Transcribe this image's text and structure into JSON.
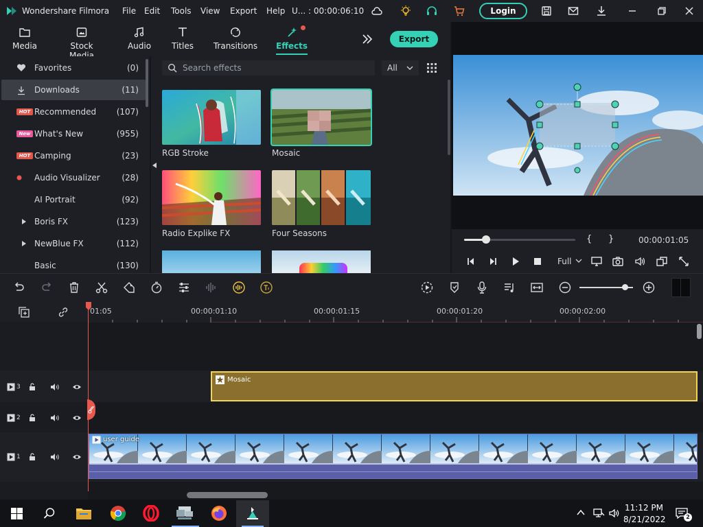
{
  "app": {
    "title": "Wondershare Filmora",
    "menu": [
      "File",
      "Edit",
      "Tools",
      "View",
      "Export",
      "Help"
    ],
    "project_status": "U... : 00:00:06:10",
    "login_label": "Login"
  },
  "tabs": [
    {
      "label": "Media",
      "icon": "folder-icon"
    },
    {
      "label": "Stock Media",
      "icon": "stock-media-icon"
    },
    {
      "label": "Audio",
      "icon": "music-note-icon"
    },
    {
      "label": "Titles",
      "icon": "text-t-icon"
    },
    {
      "label": "Transitions",
      "icon": "transition-icon"
    },
    {
      "label": "Effects",
      "icon": "effects-wand-icon",
      "active": true
    }
  ],
  "export_label": "Export",
  "categories": [
    {
      "name": "Favorites",
      "count": "(0)",
      "icon": "heart-icon"
    },
    {
      "name": "Downloads",
      "count": "(11)",
      "icon": "download-icon",
      "selected": true
    },
    {
      "name": "Recommended",
      "count": "(107)",
      "badge": "HOT"
    },
    {
      "name": "What's New",
      "count": "(955)",
      "badge": "New"
    },
    {
      "name": "Camping",
      "count": "(23)",
      "badge": "HOT"
    },
    {
      "name": "Audio Visualizer",
      "count": "(28)",
      "icon": "red-dot-icon"
    },
    {
      "name": "AI Portrait",
      "count": "(92)"
    },
    {
      "name": "Boris FX",
      "count": "(123)",
      "expandable": true
    },
    {
      "name": "NewBlue FX",
      "count": "(112)",
      "expandable": true
    },
    {
      "name": "Basic",
      "count": "(130)"
    }
  ],
  "search": {
    "placeholder": "Search effects",
    "filter": "All"
  },
  "effects": [
    {
      "label": "RGB Stroke"
    },
    {
      "label": "Mosaic",
      "selected": true
    },
    {
      "label": "Radio Explike FX"
    },
    {
      "label": "Four Seasons"
    }
  ],
  "player": {
    "progress": 0.2,
    "timecode": "00:00:01:05",
    "quality": "Full",
    "mark_in": "{",
    "mark_out": "}"
  },
  "timeline": {
    "ruler_labels": [
      "01:05",
      "00:00:01:10",
      "00:00:01:15",
      "00:00:01:20",
      "00:00:02:00"
    ],
    "tracks": [
      {
        "label": "3",
        "clip": "Mosaic"
      },
      {
        "label": "2",
        "clip": ""
      },
      {
        "label": "1",
        "clip": "user guide"
      }
    ],
    "zoom": 0.85
  },
  "taskbar": {
    "time": "11:12 PM",
    "date": "8/21/2022",
    "notifications": "2"
  },
  "colors": {
    "accent": "#34d1b6",
    "clip_effect": "#8a6f2f",
    "clip_effect_border": "#f1d45a",
    "clip_video": "#5a5fa8",
    "playhead": "#e8584f"
  }
}
